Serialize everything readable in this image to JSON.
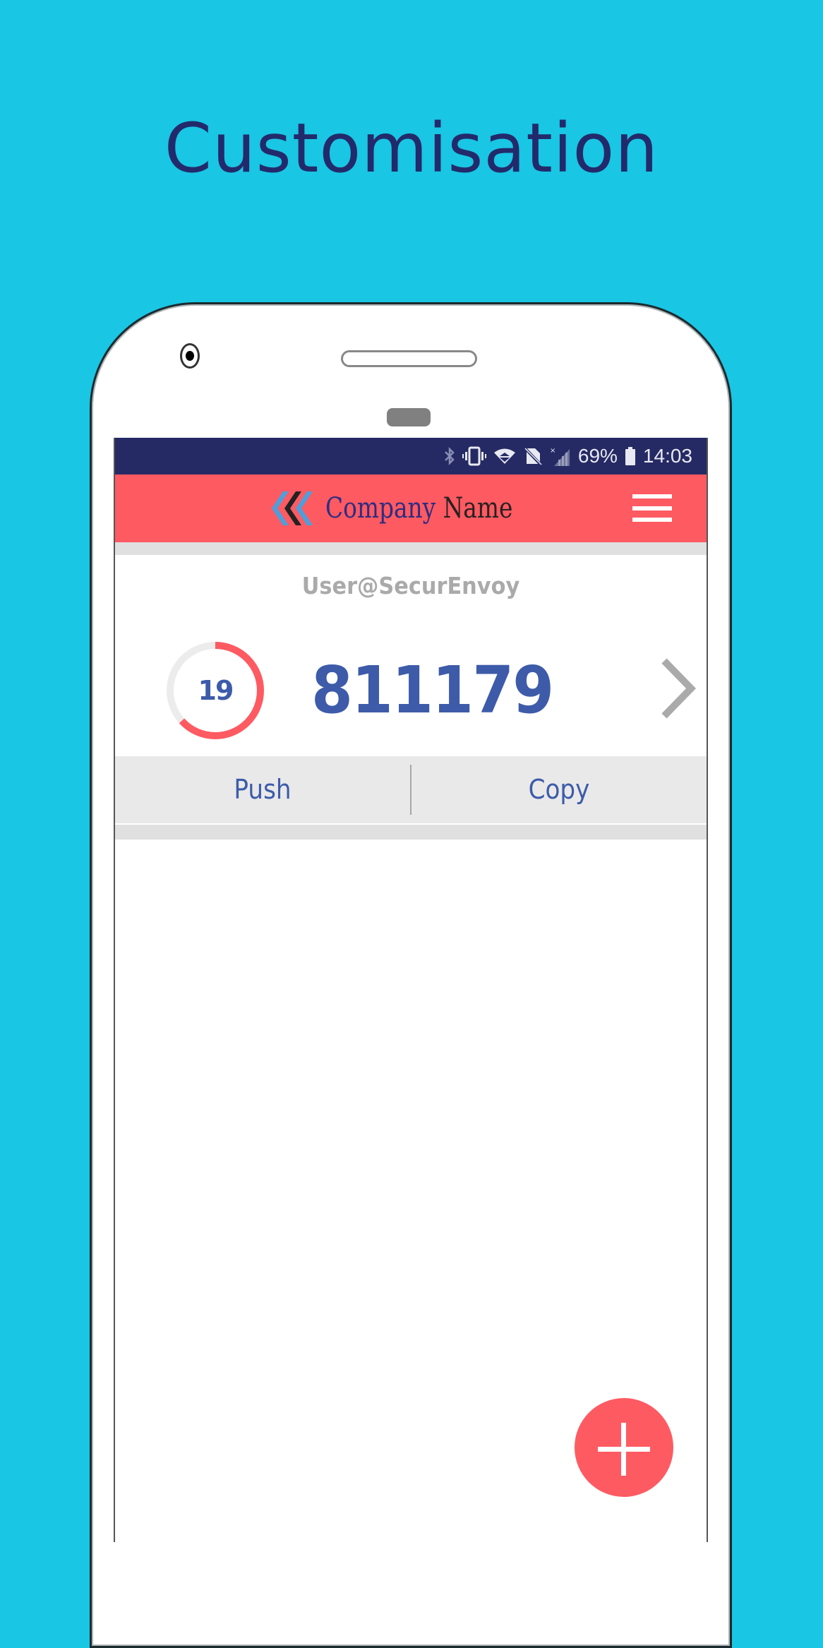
{
  "page": {
    "title": "Customisation",
    "background_color": "#19c6e4"
  },
  "status_bar": {
    "icons": [
      "bluetooth-icon",
      "vibrate-icon",
      "wifi-icon",
      "no-sim-icon",
      "signal-icon"
    ],
    "battery_percent": "69%",
    "time": "14:03"
  },
  "header": {
    "logo_company": "Company",
    "logo_name": "Name",
    "menu_icon": "hamburger-icon",
    "color": "#fe5a62"
  },
  "token": {
    "username": "User@SecurEnvoy",
    "seconds_remaining": "19",
    "period_seconds": 30,
    "remaining_fraction": 0.633,
    "code": "811179",
    "next_icon": "chevron-right-icon"
  },
  "actions": {
    "push_label": "Push",
    "copy_label": "Copy"
  },
  "fab": {
    "icon": "plus-icon"
  }
}
